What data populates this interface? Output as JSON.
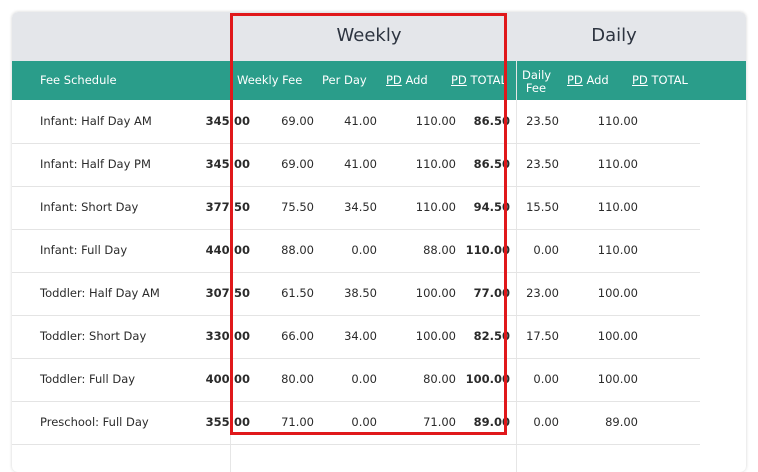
{
  "groups": {
    "weekly": "Weekly",
    "daily": "Daily"
  },
  "headers": {
    "fee_schedule": "Fee Schedule",
    "weekly_fee": "Weekly Fee",
    "per_day": "Per Day",
    "weekly_pd_add_prefix": "PD",
    "weekly_pd_add_suffix": " Add",
    "weekly_pd_total_prefix": "PD",
    "weekly_pd_total_suffix": " TOTAL",
    "daily_fee_line1": "Daily",
    "daily_fee_line2": "Fee",
    "daily_pd_add_prefix": "PD",
    "daily_pd_add_suffix": " Add",
    "daily_pd_total_prefix": "PD",
    "daily_pd_total_suffix": " TOTAL"
  },
  "rows": [
    {
      "name": "Infant: Half Day AM",
      "weekly_fee": "345.00",
      "per_day": "69.00",
      "w_pd_add": "41.00",
      "w_pd_total": "110.00",
      "daily_fee": "86.50",
      "d_pd_add": "23.50",
      "d_pd_total": "110.00"
    },
    {
      "name": "Infant: Half Day PM",
      "weekly_fee": "345.00",
      "per_day": "69.00",
      "w_pd_add": "41.00",
      "w_pd_total": "110.00",
      "daily_fee": "86.50",
      "d_pd_add": "23.50",
      "d_pd_total": "110.00"
    },
    {
      "name": "Infant: Short Day",
      "weekly_fee": "377.50",
      "per_day": "75.50",
      "w_pd_add": "34.50",
      "w_pd_total": "110.00",
      "daily_fee": "94.50",
      "d_pd_add": "15.50",
      "d_pd_total": "110.00"
    },
    {
      "name": "Infant: Full Day",
      "weekly_fee": "440.00",
      "per_day": "88.00",
      "w_pd_add": "0.00",
      "w_pd_total": "88.00",
      "daily_fee": "110.00",
      "d_pd_add": "0.00",
      "d_pd_total": "110.00"
    },
    {
      "name": "Toddler: Half Day AM",
      "weekly_fee": "307.50",
      "per_day": "61.50",
      "w_pd_add": "38.50",
      "w_pd_total": "100.00",
      "daily_fee": "77.00",
      "d_pd_add": "23.00",
      "d_pd_total": "100.00"
    },
    {
      "name": "Toddler: Short Day",
      "weekly_fee": "330.00",
      "per_day": "66.00",
      "w_pd_add": "34.00",
      "w_pd_total": "100.00",
      "daily_fee": "82.50",
      "d_pd_add": "17.50",
      "d_pd_total": "100.00"
    },
    {
      "name": "Toddler: Full Day",
      "weekly_fee": "400.00",
      "per_day": "80.00",
      "w_pd_add": "0.00",
      "w_pd_total": "80.00",
      "daily_fee": "100.00",
      "d_pd_add": "0.00",
      "d_pd_total": "100.00"
    },
    {
      "name": "Preschool: Full Day",
      "weekly_fee": "355.00",
      "per_day": "71.00",
      "w_pd_add": "0.00",
      "w_pd_total": "71.00",
      "daily_fee": "89.00",
      "d_pd_add": "0.00",
      "d_pd_total": "89.00"
    }
  ],
  "colors": {
    "header_bg": "#2a9d8a",
    "group_bg": "#e4e6ea",
    "highlight_border": "#e0181b"
  }
}
